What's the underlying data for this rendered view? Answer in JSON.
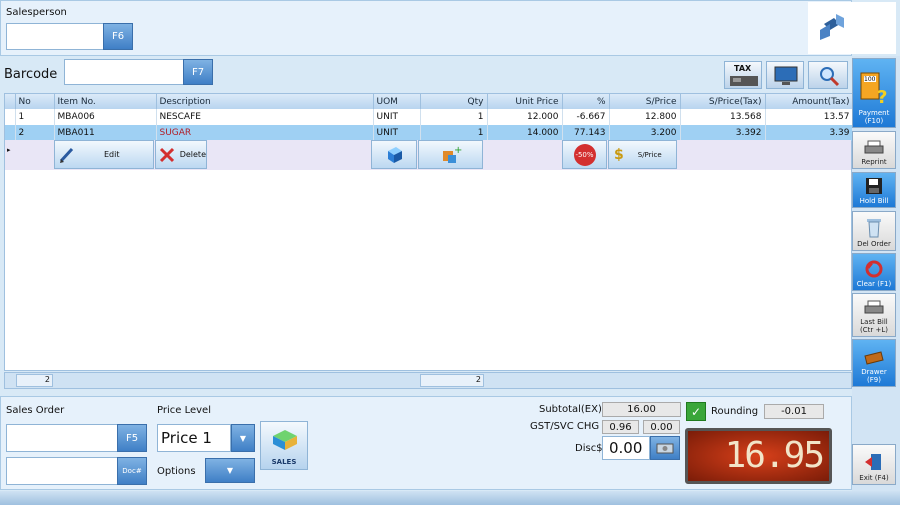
{
  "salesperson": {
    "label": "Salesperson",
    "value": "",
    "key": "F6"
  },
  "barcode": {
    "label": "Barcode",
    "value": "",
    "key": "F7"
  },
  "toolbar": {
    "tax_label": "TAX"
  },
  "grid": {
    "headers": [
      "No",
      "Item No.",
      "Description",
      "UOM",
      "Qty",
      "Unit Price",
      "%",
      "S/Price",
      "S/Price(Tax)",
      "Amount(Tax)"
    ],
    "rows": [
      {
        "no": "1",
        "item": "MBA006",
        "desc": "NESCAFE",
        "uom": "UNIT",
        "qty": "1",
        "unit_price": "12.000",
        "pct": "-6.667",
        "sprice": "12.800",
        "sprice_tax": "13.568",
        "amount": "13.57"
      },
      {
        "no": "2",
        "item": "MBA011",
        "desc": "SUGAR",
        "uom": "UNIT",
        "qty": "1",
        "unit_price": "14.000",
        "pct": "77.143",
        "sprice": "3.200",
        "sprice_tax": "3.392",
        "amount": "3.39"
      }
    ],
    "actions": {
      "edit": "Edit",
      "delete": "Delete",
      "discount_badge": "-50%",
      "sprice": "S/Price"
    },
    "footer": {
      "count": "2",
      "qty_total": "2"
    }
  },
  "sales_order": {
    "label": "Sales Order",
    "value": "",
    "key": "F5",
    "doc_key": "Doc#"
  },
  "price_level": {
    "label": "Price Level",
    "value": "Price 1"
  },
  "options": {
    "label": "Options"
  },
  "sales_button": {
    "label": "SALES"
  },
  "totals": {
    "subtotal_label": "Subtotal(EX)",
    "subtotal": "16.00",
    "gst_label": "GST/SVC CHG",
    "gst1": "0.96",
    "gst2": "0.00",
    "disc_label": "Disc$",
    "disc": "0.00",
    "rounding_label": "Rounding",
    "rounding": "-0.01",
    "grand_total": "16.95"
  },
  "side": [
    {
      "label": "Payment\n(F10)",
      "icon": "payment-icon"
    },
    {
      "label": "Reprint",
      "icon": "printer-icon"
    },
    {
      "label": "Hold Bill",
      "icon": "floppy-icon"
    },
    {
      "label": "Del Order",
      "icon": "trash-icon"
    },
    {
      "label": "Clear (F1)",
      "icon": "clear-icon"
    },
    {
      "label": "Last Bill\n(Ctr +L)",
      "icon": "printer-icon"
    },
    {
      "label": "Drawer\n(F9)",
      "icon": "drawer-icon"
    },
    {
      "label": "Exit (F4)",
      "icon": "exit-icon"
    }
  ]
}
